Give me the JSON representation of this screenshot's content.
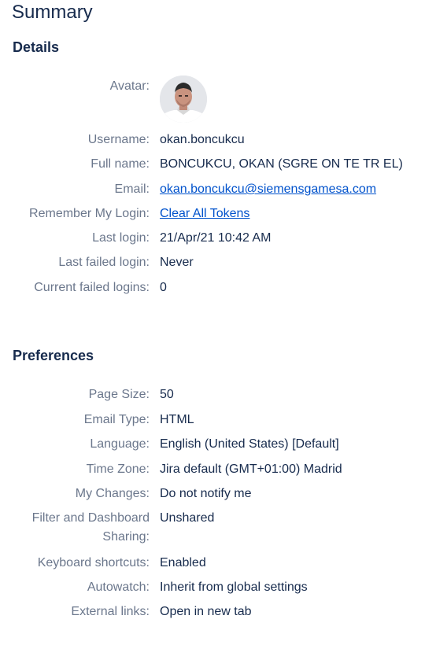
{
  "page_title": "Summary",
  "details": {
    "title": "Details",
    "avatar_label": "Avatar:",
    "rows": [
      {
        "label": "Username:",
        "value": "okan.boncukcu"
      },
      {
        "label": "Full name:",
        "value": "BONCUKCU, OKAN (SGRE ON TE TR EL)"
      },
      {
        "label": "Email:",
        "value": "okan.boncukcu@siemensgamesa.com"
      },
      {
        "label": "Remember My Login:",
        "value": "Clear All Tokens"
      },
      {
        "label": "Last login:",
        "value": "21/Apr/21 10:42 AM"
      },
      {
        "label": "Last failed login:",
        "value": "Never"
      },
      {
        "label": "Current failed logins:",
        "value": "0"
      }
    ]
  },
  "preferences": {
    "title": "Preferences",
    "rows": [
      {
        "label": "Page Size:",
        "value": "50"
      },
      {
        "label": "Email Type:",
        "value": "HTML"
      },
      {
        "label": "Language:",
        "value": "English (United States) [Default]"
      },
      {
        "label": "Time Zone:",
        "value": "Jira default (GMT+01:00) Madrid"
      },
      {
        "label": "My Changes:",
        "value": "Do not notify me"
      },
      {
        "label": "Filter and Dashboard Sharing:",
        "value": "Unshared"
      },
      {
        "label": "Keyboard shortcuts:",
        "value": "Enabled"
      },
      {
        "label": "Autowatch:",
        "value": "Inherit from global settings"
      },
      {
        "label": "External links:",
        "value": "Open in new tab"
      }
    ]
  },
  "colors": {
    "text": "#172b4d",
    "label": "#6b778c",
    "link": "#0052cc"
  }
}
